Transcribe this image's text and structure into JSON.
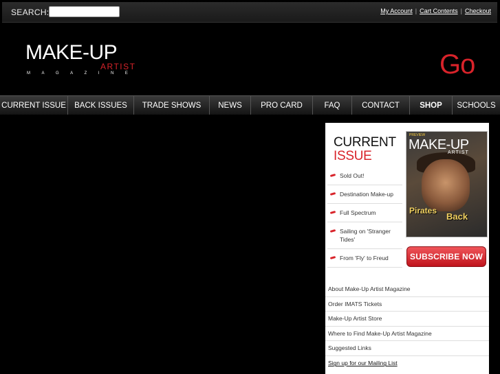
{
  "topbar": {
    "search_label": "SEARCH:",
    "search_value": "",
    "links": [
      "My Account",
      "Cart Contents",
      "Checkout"
    ]
  },
  "header": {
    "logo_main": "MAKE-UP",
    "logo_artist": "ARTIST",
    "logo_magazine": "MAGAZINE",
    "go_text": "Go"
  },
  "nav": {
    "items": [
      {
        "label": "CURRENT ISSUE",
        "bold": false
      },
      {
        "label": "BACK ISSUES",
        "bold": false
      },
      {
        "label": "TRADE SHOWS",
        "bold": false
      },
      {
        "label": "NEWS",
        "bold": false
      },
      {
        "label": "PRO CARD",
        "bold": false
      },
      {
        "label": "FAQ",
        "bold": false
      },
      {
        "label": "CONTACT",
        "bold": false
      },
      {
        "label": "SHOP",
        "bold": true
      },
      {
        "label": "SCHOOLS",
        "bold": false
      }
    ]
  },
  "current_issue": {
    "title_line1": "CURRENT",
    "title_line2": "ISSUE",
    "articles": [
      "Sold Out!",
      "Destination Make-up",
      "Full Spectrum",
      "Sailing on 'Stranger Tides'",
      "From 'Fly' to Freud"
    ],
    "cover": {
      "top_text": "PREVIEW",
      "logo": "MAKE-UP",
      "artist": "ARTIST",
      "headline1": "Pirates",
      "headline2": "Back"
    },
    "subscribe_label": "SUBSCRIBE NOW"
  },
  "sidebar_links": [
    "About Make-Up Artist Magazine",
    "Order IMATS Tickets",
    "Make-Up Artist Store",
    "Where to Find Make-Up Artist Magazine",
    "Suggested Links",
    "Sign up for our Mailing List"
  ],
  "colors": {
    "accent": "#d8232a",
    "background": "#000000",
    "panel": "#ffffff"
  }
}
